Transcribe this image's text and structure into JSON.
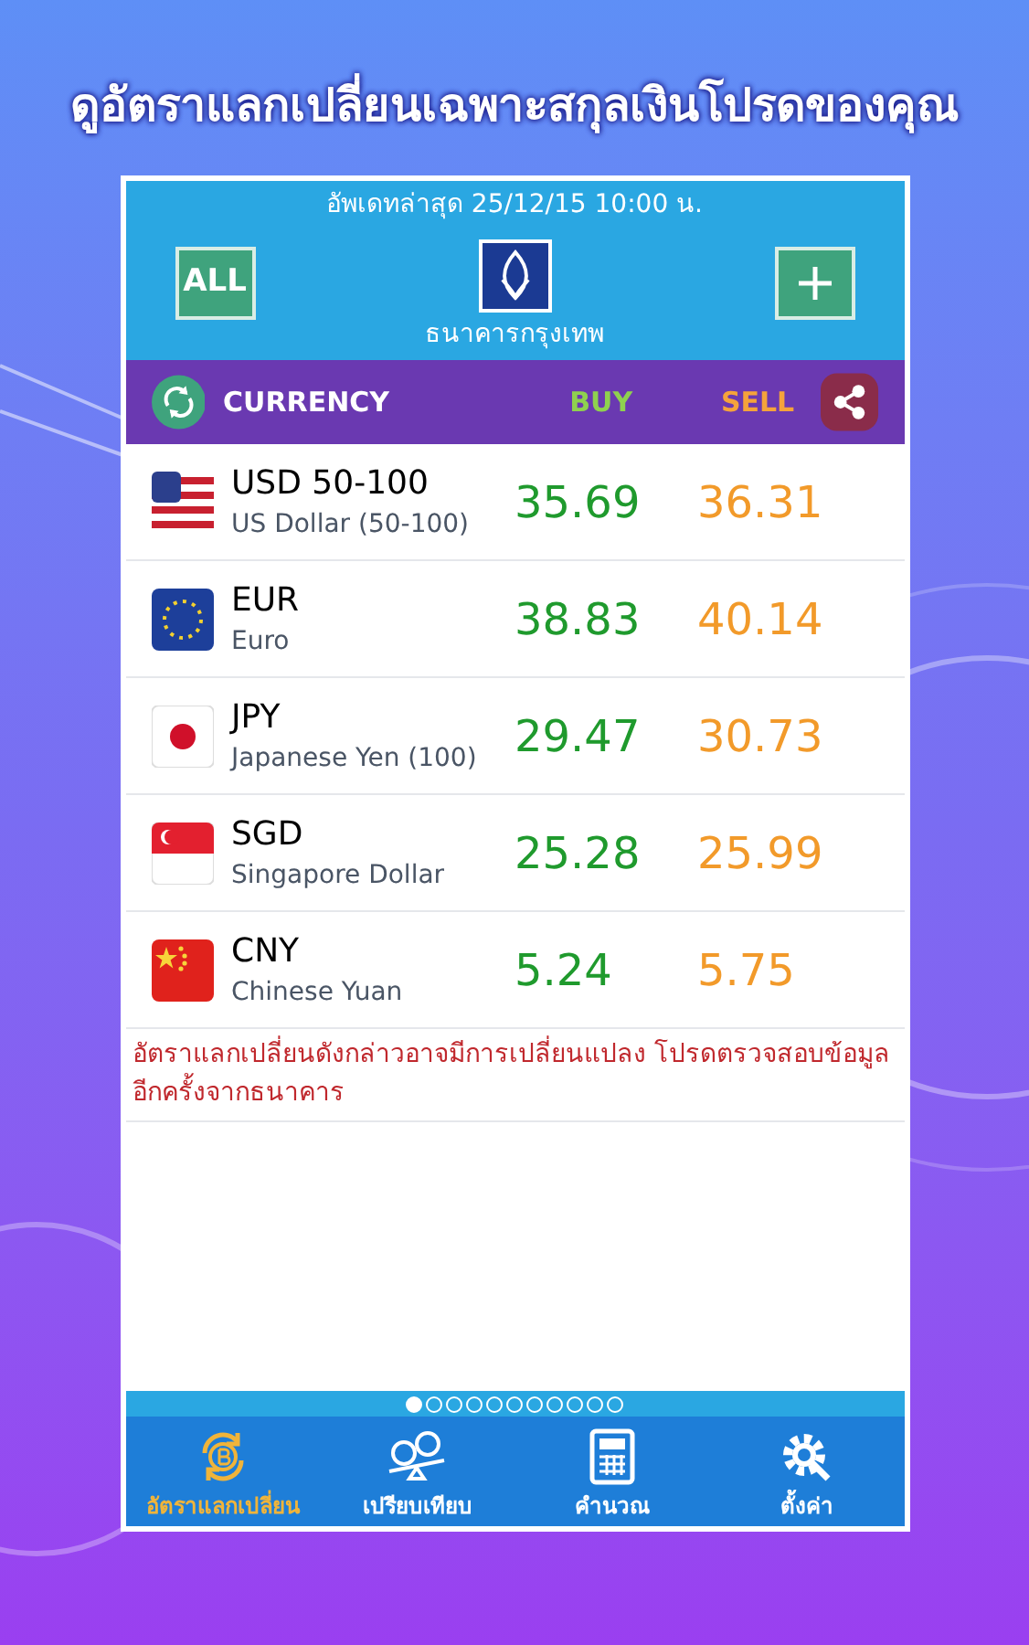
{
  "headline": "ดูอัตราแลกเปลี่ยนเฉพาะสกุลเงินโปรดของคุณ",
  "header": {
    "updated": "อัพเดทล่าสุด 25/12/15 10:00 น.",
    "all_button": "ALL",
    "bank_name": "ธนาคารกรุงเทพ"
  },
  "columns": {
    "currency": "CURRENCY",
    "buy": "BUY",
    "sell": "SELL"
  },
  "rows": [
    {
      "code": "USD 50-100",
      "name": "US Dollar (50-100)",
      "buy": "35.69",
      "sell": "36.31"
    },
    {
      "code": "EUR",
      "name": "Euro",
      "buy": "38.83",
      "sell": "40.14"
    },
    {
      "code": "JPY",
      "name": "Japanese Yen (100)",
      "buy": "29.47",
      "sell": "30.73"
    },
    {
      "code": "SGD",
      "name": "Singapore Dollar",
      "buy": "25.28",
      "sell": "25.99"
    },
    {
      "code": "CNY",
      "name": "Chinese Yuan",
      "buy": "5.24",
      "sell": "5.75"
    }
  ],
  "note": "อัตราแลกเปลี่ยนดังกล่าวอาจมีการเปลี่ยนแปลง โปรดตรวจสอบข้อมูลอีกครั้งจากธนาคาร",
  "pages": [
    {
      "selected": true
    },
    {
      "selected": false
    },
    {
      "selected": false
    },
    {
      "selected": false
    },
    {
      "selected": false
    },
    {
      "selected": false
    },
    {
      "selected": false
    },
    {
      "selected": false
    },
    {
      "selected": false
    },
    {
      "selected": false
    },
    {
      "selected": false
    }
  ],
  "nav": [
    {
      "label": "อัตราแลกเปลี่ยน",
      "selected": true
    },
    {
      "label": "เปรียบเทียบ",
      "selected": false
    },
    {
      "label": "คำนวณ",
      "selected": false
    },
    {
      "label": "ตั้งค่า",
      "selected": false
    }
  ]
}
